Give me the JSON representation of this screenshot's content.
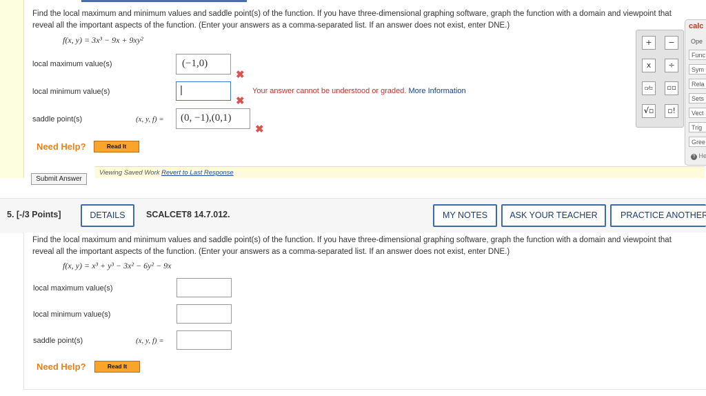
{
  "q4": {
    "question_text_line1": "Find the local maximum and minimum values and saddle point(s) of the function. If you have three-dimensional graphing software, graph the function with a domain and viewpoint that",
    "question_text_line2": "reveal all the important aspects of the function. (Enter your answers as a comma-separated list. If an answer does not exist, enter DNE.)",
    "function": "f(x, y) = 3x³ − 9x + 9xy²",
    "local_max_label": "local maximum value(s)",
    "local_max_value": "(−1,0)",
    "local_min_label": "local minimum value(s)",
    "local_min_value": "|",
    "error_text": "Your answer cannot be understood or graded.",
    "more_info": "More Information",
    "saddle_label": "saddle point(s)",
    "saddle_prefix": "(x, y, f) =",
    "saddle_value": "(0, −1),(0,1)",
    "need_help": "Need Help?",
    "read_it": "Read It",
    "submit": "Submit Answer",
    "saved_text": "Viewing Saved Work",
    "revert_link": "Revert to Last Response",
    "wrong_mark": "✖"
  },
  "palette": {
    "buttons": [
      "+",
      "−",
      "x",
      "÷",
      "▫⁄▫",
      "▫▫",
      "√▫",
      "▫!"
    ]
  },
  "calculator": {
    "title": "calc",
    "tabs": [
      "Ope",
      "Func",
      "Sym",
      "Rela",
      "Sets",
      "Vect",
      "Trig",
      "Gree"
    ],
    "help": "He"
  },
  "q5": {
    "points_label": "5.  [-/3 Points]",
    "details": "DETAILS",
    "code": "SCALCET8 14.7.012.",
    "my_notes": "MY NOTES",
    "ask_teacher": "ASK YOUR TEACHER",
    "practice": "PRACTICE ANOTHER",
    "question_text_line1": "Find the local maximum and minimum values and saddle point(s) of the function. If you have three-dimensional graphing software, graph the function with a domain and viewpoint that",
    "question_text_line2": "reveal all the important aspects of the function. (Enter your answers as a comma-separated list. If an answer does not exist, enter DNE.)",
    "function": "f(x, y) = x³ + y³ − 3x² − 6y² − 9x",
    "local_max_label": "local maximum value(s)",
    "local_min_label": "local minimum value(s)",
    "saddle_label": "saddle point(s)",
    "saddle_prefix": "(x, y, f) =",
    "need_help": "Need Help?",
    "read_it": "Read It"
  }
}
